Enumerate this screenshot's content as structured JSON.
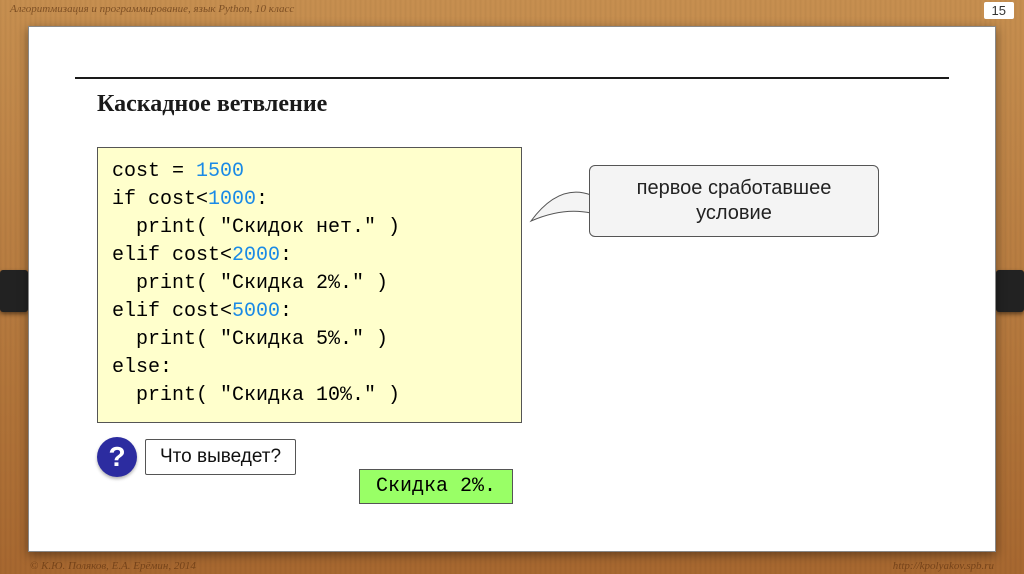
{
  "header": {
    "breadcrumb": "Алгоритмизация и программирование, язык Python, 10 класс",
    "page_number": "15"
  },
  "slide": {
    "title": "Каскадное ветвление",
    "code": {
      "l1a": "cost = ",
      "l1n": "1500",
      "l2a": "if cost<",
      "l2n": "1000",
      "l2b": ":",
      "l3": "  print( \"Скидок нет.\" )",
      "l4a": "elif cost<",
      "l4n": "2000",
      "l4b": ":",
      "l5": "  print( \"Скидка 2%.\" )",
      "l6a": "elif cost<",
      "l6n": "5000",
      "l6b": ":",
      "l7": "  print( \"Скидка 5%.\" )",
      "l8": "else:",
      "l9": "  print( \"Скидка 10%.\" )"
    },
    "callout": "первое сработавшее условие",
    "question_mark": "?",
    "question_label": "Что выведет?",
    "answer": "Скидка 2%."
  },
  "footer": {
    "left": "© К.Ю. Поляков, Е.А. Ерёмин, 2014",
    "right": "http://kpolyakov.spb.ru"
  }
}
